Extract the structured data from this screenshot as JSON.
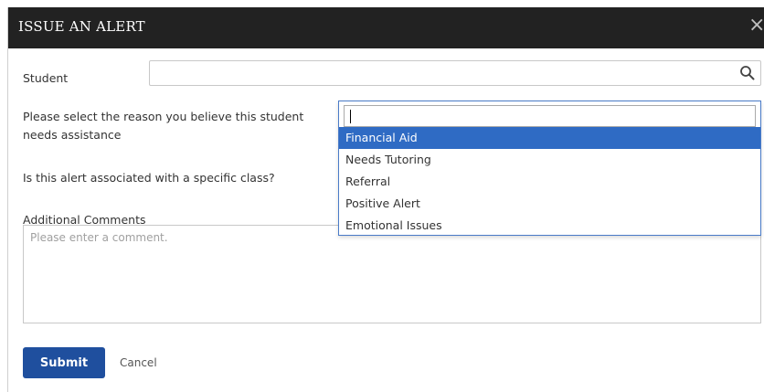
{
  "modal": {
    "title": "ISSUE AN ALERT",
    "close_glyph": "×"
  },
  "student": {
    "label": "Student",
    "value": "",
    "icon": "search-icon"
  },
  "reason": {
    "label": "Please select the reason you believe this student needs assistance",
    "search_value": "",
    "options": [
      {
        "label": "Financial Aid",
        "selected": true
      },
      {
        "label": "Needs Tutoring",
        "selected": false
      },
      {
        "label": "Referral",
        "selected": false
      },
      {
        "label": "Positive Alert",
        "selected": false
      },
      {
        "label": "Emotional Issues",
        "selected": false
      }
    ]
  },
  "class_question": {
    "label": "Is this alert associated with a specific class?"
  },
  "comments": {
    "label": "Additional Comments",
    "placeholder": "Please enter a comment.",
    "value": ""
  },
  "actions": {
    "submit_label": "Submit",
    "cancel_label": "Cancel"
  },
  "colors": {
    "header_bg": "#222222",
    "accent": "#1f4f9e",
    "selected_option": "#2f6bc4"
  }
}
